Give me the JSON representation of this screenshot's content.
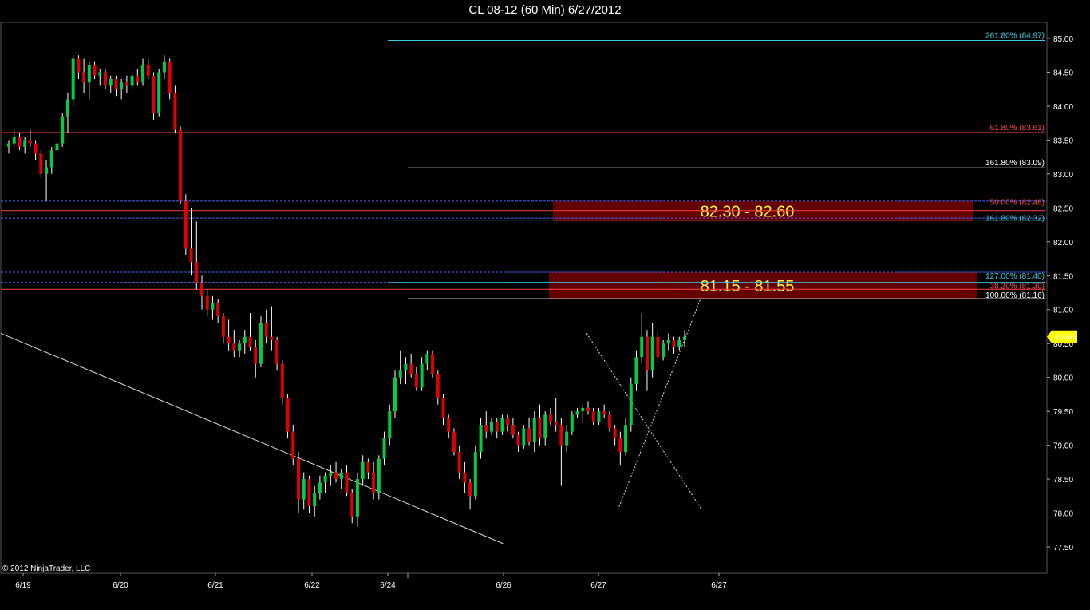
{
  "title": "CL 08-12 (60 Min)  6/27/2012",
  "copyright": "© 2012 NinjaTrader, LLC",
  "colors": {
    "background": "#000000",
    "up_candle": "#00cc44",
    "down_candle": "#e00000",
    "wick": "#ffffff",
    "fib_red": "#ff4444",
    "fib_cyan": "#33ccdd",
    "fib_white": "#ffffff",
    "fib_blue_dashed": "#4466ff",
    "zone_fill": "#6a0000",
    "zone_text": "#ffff33",
    "last_price_badge": "#ffff00"
  },
  "chart_data": {
    "type": "candlestick",
    "title": "CL 08-12 (60 Min)  6/27/2012",
    "ylim": [
      77.0,
      85.25
    ],
    "y_ticks": [
      "77.50",
      "78.00",
      "78.50",
      "79.00",
      "79.50",
      "80.00",
      "80.50",
      "81.00",
      "81.50",
      "82.00",
      "82.50",
      "83.00",
      "83.50",
      "84.00",
      "84.50",
      "85.00"
    ],
    "x_ticks": [
      "6/19",
      "6/20",
      "6/21",
      "6/22",
      "6/24",
      "6/26",
      "6/27",
      "6/27"
    ],
    "last_price": "80.60",
    "grid": false,
    "fib_levels": [
      {
        "label": "261.80% (84.97)",
        "price": 84.97,
        "color": "cyan",
        "style": "solid"
      },
      {
        "label": "61.80% (83.61)",
        "price": 83.61,
        "color": "red",
        "style": "solid"
      },
      {
        "label": "161.80% (83.09)",
        "price": 83.09,
        "color": "white",
        "style": "solid"
      },
      {
        "label": "50.00% (82.46)",
        "price": 82.46,
        "color": "red",
        "style": "solid"
      },
      {
        "label": "161.80% (82.32)",
        "price": 82.32,
        "color": "cyan",
        "style": "solid"
      },
      {
        "label": "127.00% (81.40)",
        "price": 81.4,
        "color": "cyan",
        "style": "solid"
      },
      {
        "label": "38.20% (81.30)",
        "price": 81.3,
        "color": "red",
        "style": "solid"
      },
      {
        "label": "100.00% (81.16)",
        "price": 81.16,
        "color": "white",
        "style": "solid"
      }
    ],
    "dashed_levels": [
      82.6,
      82.35,
      81.55,
      81.4
    ],
    "zones": [
      {
        "label": "82.30 - 82.60",
        "low": 82.3,
        "high": 82.6
      },
      {
        "label": "81.15 - 81.55",
        "low": 81.15,
        "high": 81.55
      }
    ],
    "trendlines": [
      {
        "from": [
          0,
          80.65
        ],
        "to": [
          0.48,
          77.55
        ]
      },
      {
        "from": [
          0.56,
          80.65
        ],
        "to": [
          0.67,
          78.05
        ]
      },
      {
        "from": [
          0.59,
          78.05
        ],
        "to": [
          0.67,
          81.2
        ]
      }
    ],
    "candles": [
      [
        83.4,
        83.5,
        83.3,
        83.45
      ],
      [
        83.45,
        83.65,
        83.4,
        83.55
      ],
      [
        83.55,
        83.6,
        83.35,
        83.4
      ],
      [
        83.4,
        83.55,
        83.3,
        83.5
      ],
      [
        83.5,
        83.65,
        83.4,
        83.45
      ],
      [
        83.45,
        83.5,
        83.2,
        83.3
      ],
      [
        83.3,
        83.35,
        82.95,
        83.0
      ],
      [
        83.0,
        83.2,
        82.6,
        83.1
      ],
      [
        83.1,
        83.4,
        83.0,
        83.35
      ],
      [
        83.35,
        83.5,
        83.3,
        83.45
      ],
      [
        83.45,
        83.9,
        83.4,
        83.85
      ],
      [
        83.85,
        84.2,
        83.6,
        84.1
      ],
      [
        84.1,
        84.75,
        84.0,
        84.7
      ],
      [
        84.7,
        84.75,
        84.4,
        84.5
      ],
      [
        84.5,
        84.7,
        84.2,
        84.35
      ],
      [
        84.35,
        84.65,
        84.1,
        84.6
      ],
      [
        84.6,
        84.65,
        84.4,
        84.45
      ],
      [
        84.45,
        84.55,
        84.3,
        84.5
      ],
      [
        84.5,
        84.55,
        84.25,
        84.3
      ],
      [
        84.3,
        84.45,
        84.2,
        84.4
      ],
      [
        84.4,
        84.45,
        84.15,
        84.25
      ],
      [
        84.25,
        84.4,
        84.1,
        84.35
      ],
      [
        84.35,
        84.45,
        84.2,
        84.3
      ],
      [
        84.3,
        84.5,
        84.25,
        84.45
      ],
      [
        84.45,
        84.55,
        84.3,
        84.35
      ],
      [
        84.35,
        84.7,
        84.3,
        84.6
      ],
      [
        84.6,
        84.7,
        84.4,
        84.45
      ],
      [
        84.45,
        84.5,
        83.8,
        83.9
      ],
      [
        83.9,
        84.55,
        83.85,
        84.5
      ],
      [
        84.5,
        84.75,
        84.4,
        84.65
      ],
      [
        84.65,
        84.7,
        84.1,
        84.2
      ],
      [
        84.2,
        84.3,
        83.6,
        83.65
      ],
      [
        83.65,
        83.7,
        82.55,
        82.6
      ],
      [
        82.6,
        82.7,
        81.8,
        81.9
      ],
      [
        81.9,
        82.5,
        81.5,
        81.7
      ],
      [
        81.7,
        82.3,
        81.3,
        81.4
      ],
      [
        81.4,
        81.5,
        81.0,
        81.2
      ],
      [
        81.2,
        81.3,
        80.9,
        81.0
      ],
      [
        81.0,
        81.2,
        80.85,
        81.1
      ],
      [
        81.1,
        81.15,
        80.8,
        80.9
      ],
      [
        80.9,
        80.95,
        80.5,
        80.6
      ],
      [
        80.6,
        80.85,
        80.4,
        80.5
      ],
      [
        80.5,
        80.7,
        80.3,
        80.4
      ],
      [
        80.4,
        80.55,
        80.3,
        80.5
      ],
      [
        80.5,
        80.7,
        80.35,
        80.6
      ],
      [
        80.6,
        80.95,
        80.4,
        80.45
      ],
      [
        80.45,
        80.55,
        80.0,
        80.2
      ],
      [
        80.2,
        80.9,
        80.15,
        80.8
      ],
      [
        80.8,
        81.0,
        80.5,
        80.6
      ],
      [
        80.6,
        81.05,
        80.4,
        80.55
      ],
      [
        80.55,
        80.6,
        80.1,
        80.2
      ],
      [
        80.2,
        80.25,
        79.6,
        79.7
      ],
      [
        79.7,
        79.75,
        79.1,
        79.2
      ],
      [
        79.2,
        79.3,
        78.7,
        78.8
      ],
      [
        78.8,
        78.9,
        78.0,
        78.2
      ],
      [
        78.2,
        78.6,
        78.05,
        78.5
      ],
      [
        78.5,
        78.55,
        78.0,
        78.1
      ],
      [
        78.1,
        78.4,
        77.95,
        78.3
      ],
      [
        78.3,
        78.55,
        78.2,
        78.45
      ],
      [
        78.45,
        78.6,
        78.3,
        78.55
      ],
      [
        78.55,
        78.7,
        78.4,
        78.6
      ],
      [
        78.6,
        78.75,
        78.45,
        78.5
      ],
      [
        78.5,
        78.65,
        78.35,
        78.6
      ],
      [
        78.6,
        78.7,
        78.25,
        78.3
      ],
      [
        78.3,
        78.35,
        77.85,
        77.95
      ],
      [
        77.95,
        78.6,
        77.8,
        78.5
      ],
      [
        78.5,
        78.85,
        78.4,
        78.75
      ],
      [
        78.75,
        78.8,
        78.5,
        78.6
      ],
      [
        78.6,
        78.75,
        78.2,
        78.3
      ],
      [
        78.3,
        78.85,
        78.2,
        78.8
      ],
      [
        78.8,
        79.2,
        78.7,
        79.1
      ],
      [
        79.1,
        79.6,
        79.0,
        79.5
      ],
      [
        79.5,
        80.1,
        79.4,
        80.0
      ],
      [
        80.0,
        80.4,
        79.9,
        80.1
      ],
      [
        80.1,
        80.3,
        79.9,
        80.2
      ],
      [
        80.2,
        80.35,
        80.0,
        80.05
      ],
      [
        80.05,
        80.15,
        79.8,
        79.85
      ],
      [
        79.85,
        80.3,
        79.8,
        80.2
      ],
      [
        80.2,
        80.4,
        80.1,
        80.35
      ],
      [
        80.35,
        80.4,
        80.0,
        80.05
      ],
      [
        80.05,
        80.1,
        79.6,
        79.7
      ],
      [
        79.7,
        79.75,
        79.3,
        79.4
      ],
      [
        79.4,
        79.45,
        79.1,
        79.2
      ],
      [
        79.2,
        79.25,
        78.85,
        78.9
      ],
      [
        78.9,
        79.0,
        78.5,
        78.6
      ],
      [
        78.6,
        78.75,
        78.3,
        78.45
      ],
      [
        78.45,
        78.5,
        78.05,
        78.25
      ],
      [
        78.25,
        79.0,
        78.2,
        78.9
      ],
      [
        78.9,
        79.4,
        78.8,
        79.3
      ],
      [
        79.3,
        79.5,
        79.1,
        79.2
      ],
      [
        79.2,
        79.4,
        79.15,
        79.35
      ],
      [
        79.35,
        79.4,
        79.1,
        79.2
      ],
      [
        79.2,
        79.45,
        79.15,
        79.4
      ],
      [
        79.4,
        79.45,
        79.2,
        79.3
      ],
      [
        79.3,
        79.4,
        79.1,
        79.15
      ],
      [
        79.15,
        79.2,
        78.9,
        79.0
      ],
      [
        79.0,
        79.3,
        78.95,
        79.25
      ],
      [
        79.25,
        79.4,
        79.0,
        79.05
      ],
      [
        79.05,
        79.5,
        78.9,
        79.4
      ],
      [
        79.4,
        79.6,
        79.0,
        79.1
      ],
      [
        79.1,
        79.5,
        79.0,
        79.45
      ],
      [
        79.45,
        79.55,
        79.3,
        79.35
      ],
      [
        79.35,
        79.7,
        79.2,
        79.3
      ],
      [
        79.3,
        79.4,
        78.4,
        79.0
      ],
      [
        79.0,
        79.3,
        78.9,
        79.2
      ],
      [
        79.2,
        79.5,
        79.15,
        79.45
      ],
      [
        79.45,
        79.55,
        79.4,
        79.5
      ],
      [
        79.5,
        79.6,
        79.35,
        79.55
      ],
      [
        79.55,
        79.65,
        79.45,
        79.5
      ],
      [
        79.5,
        79.55,
        79.3,
        79.35
      ],
      [
        79.35,
        79.55,
        79.3,
        79.5
      ],
      [
        79.5,
        79.6,
        79.4,
        79.45
      ],
      [
        79.45,
        79.5,
        79.2,
        79.25
      ],
      [
        79.25,
        79.3,
        79.0,
        79.1
      ],
      [
        79.1,
        79.2,
        78.7,
        78.9
      ],
      [
        78.9,
        79.4,
        78.85,
        79.3
      ],
      [
        79.3,
        80.0,
        79.2,
        79.9
      ],
      [
        79.9,
        80.4,
        79.8,
        80.3
      ],
      [
        80.3,
        80.95,
        80.2,
        80.6
      ],
      [
        80.6,
        80.7,
        79.8,
        80.1
      ],
      [
        80.1,
        80.8,
        80.0,
        80.6
      ],
      [
        80.6,
        80.7,
        80.2,
        80.3
      ],
      [
        80.3,
        80.55,
        80.25,
        80.5
      ],
      [
        80.5,
        80.65,
        80.4,
        80.55
      ],
      [
        80.55,
        80.6,
        80.35,
        80.45
      ],
      [
        80.45,
        80.6,
        80.4,
        80.55
      ],
      [
        80.55,
        80.7,
        80.45,
        80.6
      ]
    ]
  }
}
